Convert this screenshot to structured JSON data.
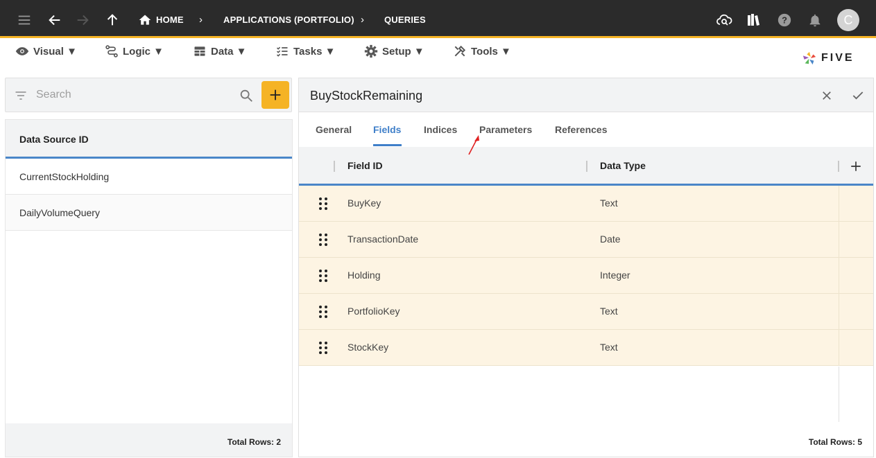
{
  "topbar": {
    "breadcrumbs": [
      "HOME",
      "APPLICATIONS (PORTFOLIO)",
      "QUERIES"
    ],
    "avatar_letter": "C",
    "icons": [
      "menu-icon",
      "back-arrow-icon",
      "forward-arrow-icon",
      "up-arrow-icon",
      "home-icon",
      "cloud-search-icon",
      "library-icon",
      "help-icon",
      "bell-icon"
    ]
  },
  "menubar": {
    "items": [
      {
        "label": "Visual ▼",
        "icon": "eye-icon"
      },
      {
        "label": "Logic ▼",
        "icon": "logic-icon"
      },
      {
        "label": "Data ▼",
        "icon": "table-icon"
      },
      {
        "label": "Tasks ▼",
        "icon": "checklist-icon"
      },
      {
        "label": "Setup ▼",
        "icon": "gear-icon"
      },
      {
        "label": "Tools ▼",
        "icon": "tools-icon"
      }
    ],
    "logo_text": "FIVE"
  },
  "left": {
    "search_placeholder": "Search",
    "column_header": "Data Source ID",
    "rows": [
      "CurrentStockHolding",
      "DailyVolumeQuery"
    ],
    "footer": "Total Rows: 2"
  },
  "right": {
    "title": "BuyStockRemaining",
    "tabs": [
      "General",
      "Fields",
      "Indices",
      "Parameters",
      "References"
    ],
    "active_tab": "Fields",
    "columns": [
      "Field ID",
      "Data Type"
    ],
    "rows": [
      {
        "field_id": "BuyKey",
        "data_type": "Text"
      },
      {
        "field_id": "TransactionDate",
        "data_type": "Date"
      },
      {
        "field_id": "Holding",
        "data_type": "Integer"
      },
      {
        "field_id": "PortfolioKey",
        "data_type": "Text"
      },
      {
        "field_id": "StockKey",
        "data_type": "Text"
      }
    ],
    "footer": "Total Rows: 5"
  },
  "colors": {
    "topbar_bg": "#2b2b2b",
    "accent": "#f5b325",
    "active_tab": "#3f7fc9",
    "row_highlight": "#fdf4e3",
    "annotation_arrow": "#e02020"
  }
}
